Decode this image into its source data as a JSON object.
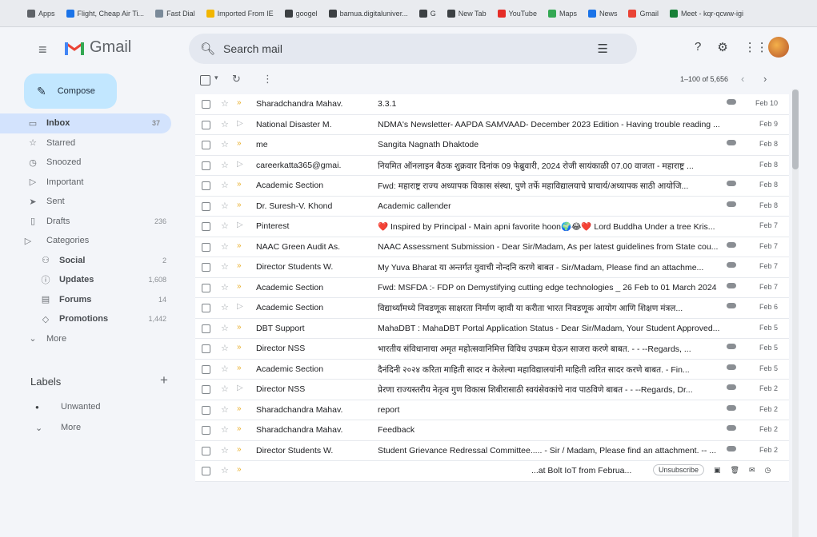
{
  "bookmarks": [
    {
      "label": "Apps",
      "color": "#5f6368"
    },
    {
      "label": "Flight, Cheap Air Ti...",
      "color": "#1a73e8"
    },
    {
      "label": "Fast Dial",
      "color": "#7a8a99"
    },
    {
      "label": "Imported From IE",
      "color": "#f2b600"
    },
    {
      "label": "googel",
      "color": "#3c4043"
    },
    {
      "label": "bamua.digitaluniver...",
      "color": "#3c4043"
    },
    {
      "label": "G",
      "color": "#3c4043"
    },
    {
      "label": "New Tab",
      "color": "#3c4043"
    },
    {
      "label": "YouTube",
      "color": "#e52d27"
    },
    {
      "label": "Maps",
      "color": "#34a853"
    },
    {
      "label": "News",
      "color": "#1a73e8"
    },
    {
      "label": "Gmail",
      "color": "#ea4335"
    },
    {
      "label": "Meet - kqr-qcww-igi",
      "color": "#188038"
    }
  ],
  "header": {
    "app_name": "Gmail",
    "search_placeholder": "Search mail"
  },
  "compose": {
    "label": "Compose"
  },
  "nav": [
    {
      "label": "Inbox",
      "count": "37",
      "icon": "inbox-icon",
      "glyph": "▭",
      "active": true
    },
    {
      "label": "Starred",
      "count": "",
      "icon": "star-icon",
      "glyph": "☆"
    },
    {
      "label": "Snoozed",
      "count": "",
      "icon": "clock-icon",
      "glyph": "◷"
    },
    {
      "label": "Important",
      "count": "",
      "icon": "important-icon",
      "glyph": "▷"
    },
    {
      "label": "Sent",
      "count": "",
      "icon": "send-icon",
      "glyph": "➤"
    },
    {
      "label": "Drafts",
      "count": "236",
      "icon": "draft-icon",
      "glyph": "▯"
    },
    {
      "label": "Categories",
      "count": "",
      "icon": "label-outline-icon",
      "glyph": "▷",
      "cat": true
    },
    {
      "label": "Social",
      "count": "2",
      "icon": "people-icon",
      "glyph": "⚇",
      "sub": true
    },
    {
      "label": "Updates",
      "count": "1,608",
      "icon": "info-icon",
      "glyph": "ⓘ",
      "sub": true
    },
    {
      "label": "Forums",
      "count": "14",
      "icon": "forum-icon",
      "glyph": "▤",
      "sub": true
    },
    {
      "label": "Promotions",
      "count": "1,442",
      "icon": "tag-icon",
      "glyph": "◇",
      "sub": true
    },
    {
      "label": "More",
      "count": "",
      "icon": "chevron-down-icon",
      "glyph": "⌄"
    }
  ],
  "labels": {
    "title": "Labels",
    "items": [
      {
        "label": "Unwanted",
        "icon": "label-icon",
        "glyph": "●"
      },
      {
        "label": "More",
        "icon": "chevron-down-icon",
        "glyph": "⌄"
      }
    ]
  },
  "toolbar": {
    "range_text": "1–100 of 5,656"
  },
  "emails": [
    {
      "sender": "Sharadchandra Mahav.",
      "subject": "3.3.1",
      "date": "Feb 10",
      "attachment": true,
      "important": true
    },
    {
      "sender": "National Disaster M.",
      "subject": "NDMA's Newsletter- AAPDA SAMVAAD- December 2023 Edition - Having trouble reading ...",
      "date": "Feb 9",
      "attachment": false,
      "important": false
    },
    {
      "sender": "me",
      "subject": "Sangita Nagnath Dhaktode",
      "date": "Feb 8",
      "attachment": true,
      "important": true
    },
    {
      "sender": "careerkatta365@gmai.",
      "subject": "नियमित ऑनलाइन बैठक शुक्रवार दिनांक 09 फेब्रुवारी, 2024 रोजी सायंकाळी 07.00 वाजता - महाराष्ट्र ...",
      "date": "Feb 8",
      "attachment": false,
      "important": false
    },
    {
      "sender": "Academic Section",
      "subject": "Fwd: महाराष्ट्र राज्य अध्यापक विकास संस्था, पुणे तर्फे महाविद्यालयाचे प्राचार्य/अध्यापक साठी आयोजि...",
      "date": "Feb 8",
      "attachment": true,
      "important": true
    },
    {
      "sender": "Dr. Suresh-V. Khond",
      "subject": "Academic callender",
      "date": "Feb 8",
      "attachment": true,
      "important": true
    },
    {
      "sender": "Pinterest",
      "subject": "❤️ Inspired by Principal - Main apni favorite hoon🌍😂❤️ Lord Buddha Under a tree Kris...",
      "date": "Feb 7",
      "attachment": false,
      "important": false
    },
    {
      "sender": "NAAC Green Audit As.",
      "subject": "NAAC Assessment Submission - Dear Sir/Madam, As per latest guidelines from State cou...",
      "date": "Feb 7",
      "attachment": true,
      "important": true
    },
    {
      "sender": "Director Students W.",
      "subject": "My Yuva Bharat या अन्तर्गत युवाची नोन्दनि करणे बाबत - Sir/Madam, Please find an attachme...",
      "date": "Feb 7",
      "attachment": true,
      "important": true
    },
    {
      "sender": "Academic Section",
      "subject": "Fwd: MSFDA :- FDP on Demystifying cutting edge technologies _ 26 Feb to 01 March 2024",
      "date": "Feb 7",
      "attachment": true,
      "important": true
    },
    {
      "sender": "Academic Section",
      "subject": "विद्यार्थ्यांमध्ये निवडणूक साक्षरता निर्माण व्हावी या करीता भारत निवडणूक आयोग आणि शिक्षण मंत्रल...",
      "date": "Feb 6",
      "attachment": true,
      "important": false
    },
    {
      "sender": "DBT Support",
      "subject": "MahaDBT : MahaDBT Portal Application Status - Dear Sir/Madam, Your Student Approved...",
      "date": "Feb 5",
      "attachment": false,
      "important": true
    },
    {
      "sender": "Director NSS",
      "subject": "भारतीय संविधानाचा अमृत महोत्सवानिमित्त विविध उपक्रम घेऊन साजरा करणे बाबत. - - --Regards, ...",
      "date": "Feb 5",
      "attachment": true,
      "important": true
    },
    {
      "sender": "Academic Section",
      "subject": "दैनंदिनी २०२४ करिता माहिती सादर न केलेल्या महाविद्यालयांनी माहिती त्वरित सादर करणे बाबत. - Fin...",
      "date": "Feb 5",
      "attachment": true,
      "important": true
    },
    {
      "sender": "Director NSS",
      "subject": "प्रेरणा राज्यस्तरीय नेतृत्व गुण विकास शिबीरासाठी स्वयंसेवकांचे नाव पाठविणे बाबत - - --Regards, Dr...",
      "date": "Feb 2",
      "attachment": true,
      "important": false
    },
    {
      "sender": "Sharadchandra Mahav.",
      "subject": "report",
      "date": "Feb 2",
      "attachment": true,
      "important": true
    },
    {
      "sender": "Sharadchandra Mahav.",
      "subject": "Feedback",
      "date": "Feb 2",
      "attachment": true,
      "important": true
    },
    {
      "sender": "Director Students W.",
      "subject": "Student Grievance Redressal Committee..... - Sir / Madam, Please find an attachment. -- ...",
      "date": "Feb 2",
      "attachment": true,
      "important": true
    },
    {
      "sender": "",
      "subject": "...at Bolt IoT from Februa...",
      "date": "",
      "attachment": false,
      "important": true,
      "hover": true,
      "unsubscribe_label": "Unsubscribe"
    }
  ]
}
